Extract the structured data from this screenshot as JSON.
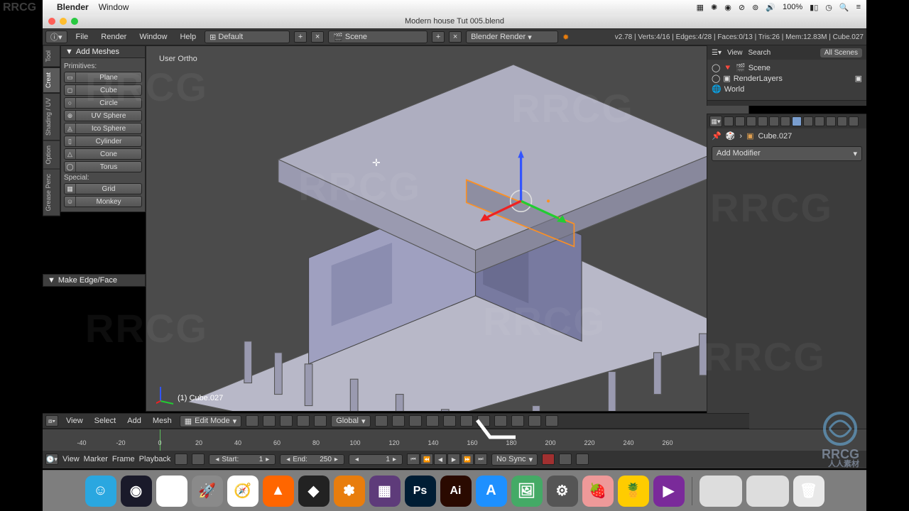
{
  "mac_menu": {
    "app": "Blender",
    "window": "Window",
    "right": {
      "battery": "100%",
      "charge_icon": "⚡"
    }
  },
  "titlebar": {
    "title": "Modern house Tut 005.blend"
  },
  "info_header": {
    "menus": [
      "File",
      "Render",
      "Window",
      "Help"
    ],
    "layout": "Default",
    "scene": "Scene",
    "engine": "Blender Render",
    "stats": "v2.78 | Verts:4/16 | Edges:4/28 | Faces:0/13 | Tris:26 | Mem:12.83M | Cube.027"
  },
  "tool_panel": {
    "title": "Add Meshes",
    "primitives_label": "Primitives:",
    "primitives": [
      "Plane",
      "Cube",
      "Circle",
      "UV Sphere",
      "Ico Sphere",
      "Cylinder",
      "Cone",
      "Torus"
    ],
    "special_label": "Special:",
    "special": [
      "Grid",
      "Monkey"
    ]
  },
  "vtabs": [
    "Tool",
    "Creat",
    "Shading / UV",
    "Option",
    "Grease Penc"
  ],
  "op_panel": {
    "title": "Make Edge/Face"
  },
  "viewport": {
    "view_label": "User Ortho",
    "object_label": "(1) Cube.027"
  },
  "outliner": {
    "header": {
      "view": "View",
      "search": "Search",
      "filter": "All Scenes"
    },
    "tree": {
      "scene": "Scene",
      "renderlayers": "RenderLayers",
      "world": "World"
    }
  },
  "properties": {
    "breadcrumb_object": "Cube.027",
    "add_modifier": "Add Modifier"
  },
  "view3d_header": {
    "menus": [
      "View",
      "Select",
      "Add",
      "Mesh"
    ],
    "mode": "Edit Mode",
    "orientation": "Global"
  },
  "timeline": {
    "ticks": [
      "-40",
      "-20",
      "0",
      "20",
      "40",
      "60",
      "80",
      "100",
      "120",
      "140",
      "160",
      "180",
      "200",
      "220",
      "240",
      "260"
    ],
    "menus": [
      "View",
      "Marker",
      "Frame",
      "Playback"
    ],
    "start_label": "Start:",
    "start_val": "1",
    "end_label": "End:",
    "end_val": "250",
    "current": "1",
    "sync": "No Sync"
  },
  "dock": {
    "icons": [
      {
        "name": "finder",
        "bg": "#2aa7e0",
        "glyph": "☺"
      },
      {
        "name": "siri",
        "bg": "#1a1a2a",
        "glyph": "◉"
      },
      {
        "name": "chrome",
        "bg": "#fff",
        "glyph": "◯"
      },
      {
        "name": "launchpad",
        "bg": "#8a8a8a",
        "glyph": "🚀"
      },
      {
        "name": "safari",
        "bg": "#fff",
        "glyph": "🧭"
      },
      {
        "name": "vlc",
        "bg": "#f60",
        "glyph": "▲"
      },
      {
        "name": "unity",
        "bg": "#222",
        "glyph": "◆"
      },
      {
        "name": "blender",
        "bg": "#e87d0d",
        "glyph": "✽"
      },
      {
        "name": "aseprite",
        "bg": "#5e3b7a",
        "glyph": "▦"
      },
      {
        "name": "photoshop",
        "bg": "#001d34",
        "glyph": "Ps"
      },
      {
        "name": "illustrator",
        "bg": "#2a0a00",
        "glyph": "Ai"
      },
      {
        "name": "appstore",
        "bg": "#1e90ff",
        "glyph": "A"
      },
      {
        "name": "preview",
        "bg": "#4a6",
        "glyph": "🖼"
      },
      {
        "name": "settings",
        "bg": "#555",
        "glyph": "⚙"
      },
      {
        "name": "app1",
        "bg": "#e99",
        "glyph": "🍓"
      },
      {
        "name": "app2",
        "bg": "#fc0",
        "glyph": "🍍"
      },
      {
        "name": "app3",
        "bg": "#7a2a9a",
        "glyph": "▶"
      }
    ]
  },
  "watermark": {
    "text": "RRCG",
    "bottom_right": "RRCG\n人人素材"
  }
}
